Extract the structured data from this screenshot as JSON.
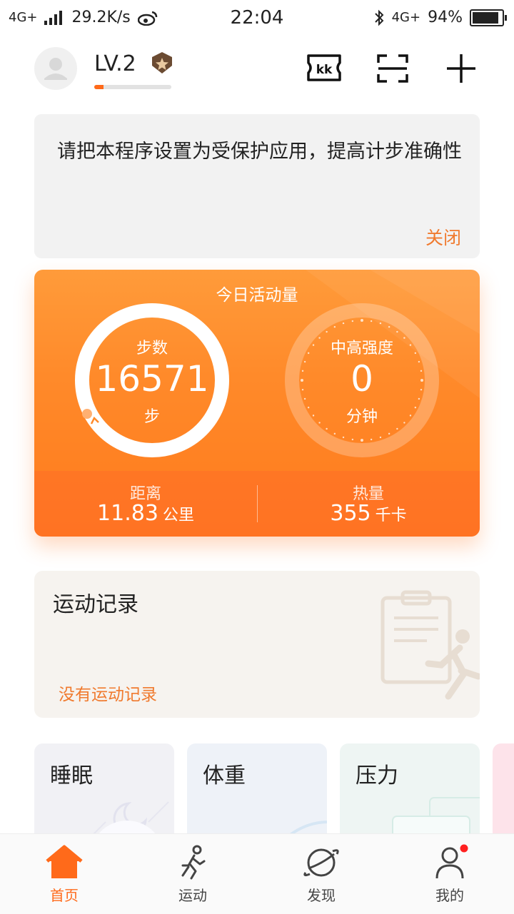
{
  "status_bar": {
    "network_left": "4G+",
    "speed": "29.2K/s",
    "time": "22:04",
    "network_right": "4G+",
    "battery": "94%"
  },
  "header": {
    "level": "LV.2",
    "level_progress": 0.12,
    "icons": [
      "kk-ticket-icon",
      "scan-icon",
      "plus-icon"
    ]
  },
  "notice": {
    "text": "请把本程序设置为受保护应用，提高计步准确性",
    "close_label": "关闭"
  },
  "activity": {
    "title": "今日活动量",
    "steps": {
      "label": "步数",
      "value": "16571",
      "unit": "步"
    },
    "intensity": {
      "label": "中高强度",
      "value": "0",
      "unit": "分钟"
    },
    "distance": {
      "label": "距离",
      "value": "11.83",
      "unit": "公里"
    },
    "calories": {
      "label": "热量",
      "value": "355",
      "unit": "千卡"
    }
  },
  "record": {
    "title": "运动记录",
    "empty_text": "没有运动记录"
  },
  "cards": [
    {
      "title": "睡眠"
    },
    {
      "title": "体重"
    },
    {
      "title": "压力"
    }
  ],
  "nav": [
    {
      "label": "首页",
      "active": true
    },
    {
      "label": "运动"
    },
    {
      "label": "发现"
    },
    {
      "label": "我的"
    }
  ],
  "colors": {
    "accent": "#ff6a1a",
    "orange_card": "#ff8a2a",
    "notice_bg": "#f2f2f2"
  }
}
